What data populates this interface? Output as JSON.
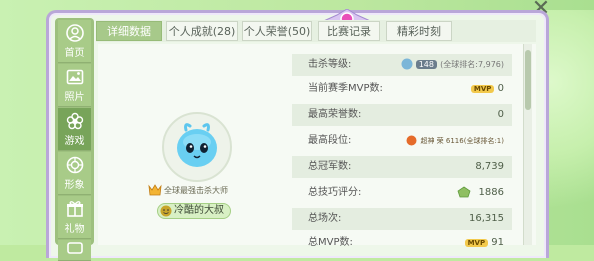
{
  "sidebar": {
    "items": [
      {
        "label": "首页",
        "icon": "home-icon"
      },
      {
        "label": "照片",
        "icon": "photo-icon"
      },
      {
        "label": "游戏",
        "icon": "flower-icon"
      },
      {
        "label": "形象",
        "icon": "appearance-icon"
      },
      {
        "label": "礼物",
        "icon": "gift-icon"
      },
      {
        "label": "",
        "icon": "chat-icon"
      }
    ]
  },
  "tabs": [
    {
      "label": "详细数据",
      "active": true
    },
    {
      "label": "个人成就(28)"
    },
    {
      "label": "个人荣誉(50)"
    },
    {
      "label": "比赛记录"
    },
    {
      "label": "精彩时刻"
    }
  ],
  "profile": {
    "title": "全球最强击杀大师",
    "nickname": "冷酷的大叔"
  },
  "stats": [
    {
      "label": "击杀等级:",
      "value": "(全球排名:7,976)",
      "badge": "148"
    },
    {
      "label": "当前赛季MVP数:",
      "value": "0",
      "badge": "MVP"
    },
    {
      "label": "最高荣誉数:",
      "value": "0"
    },
    {
      "label": "最高段位:",
      "value": "超神 荣 6116(全球排名:1)"
    },
    {
      "label": "总冠军数:",
      "value": "8,739"
    },
    {
      "label": "总技巧评分:",
      "value": "1886"
    },
    {
      "label": "总场次:",
      "value": "16,315"
    },
    {
      "label": "总MVP数:",
      "value": "91"
    }
  ],
  "colors": {
    "accent": "#a7c98a",
    "frame": "#b9a7d8",
    "background": "#c9f1b2"
  }
}
